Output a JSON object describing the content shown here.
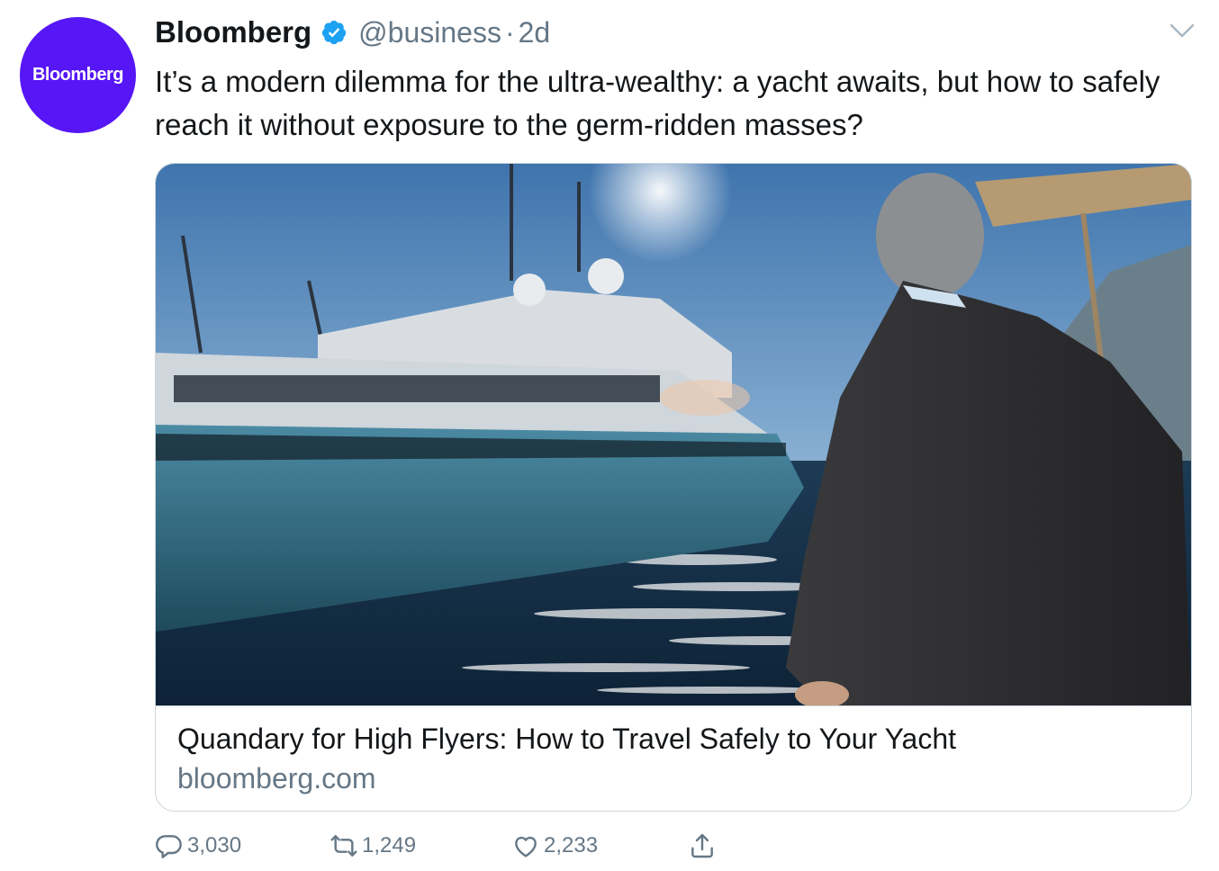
{
  "account": {
    "avatar_text": "Bloomberg",
    "display_name": "Bloomberg",
    "handle": "@business",
    "separator": "·",
    "time": "2d",
    "verified": true
  },
  "tweet": {
    "text": "It’s a modern dilemma for the ultra-wealthy: a yacht awaits, but how to safely reach it without exposure to the germ-ridden masses?"
  },
  "card": {
    "title": "Quandary for High Flyers: How to Travel Safely to Your Yacht",
    "domain": "bloomberg.com"
  },
  "actions": {
    "replies": "3,030",
    "retweets": "1,249",
    "likes": "2,233"
  },
  "colors": {
    "brand": "#5616f5",
    "verified": "#1da1f2",
    "muted": "#657786",
    "text": "#14171a",
    "border": "#ccd6dd"
  },
  "icons": [
    "verified-badge-icon",
    "chevron-down-icon",
    "reply-icon",
    "retweet-icon",
    "like-icon",
    "share-icon"
  ]
}
